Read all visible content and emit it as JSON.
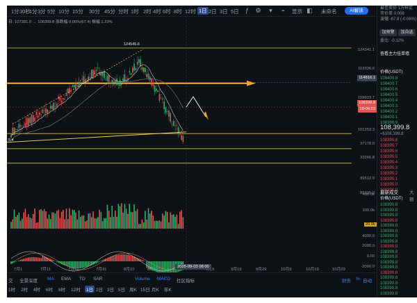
{
  "toolbar": {
    "timeframes": [
      "1分",
      "30秒",
      "1分",
      "3分",
      "5分",
      "10分",
      "15分",
      "30分",
      "45分",
      "分时",
      "1时",
      "2时",
      "4时",
      "6时",
      "8时",
      "12时",
      "1日",
      "2日",
      "3日",
      "5日"
    ],
    "active_timeframe_index": 16,
    "display_label": "显示",
    "unnamed_label": "未命名",
    "ai_label": "AI解读"
  },
  "legend": {
    "text": "日: 107281.0 → 108399.8  涨跌幅 0.06%(67.4) 振幅 1.23%",
    "ma_text": "MA(7) 108990  MA(30) 111080"
  },
  "price_axis": {
    "ticks": [
      "124341.1",
      "119336.6",
      "109923.7",
      "105016.1",
      "101253.3",
      "97178.0",
      "93266.8",
      "89512.9",
      "85925.9"
    ],
    "current_price": "108399.8",
    "countdown": "19:06:23",
    "crosshair_price": "114816.1",
    "high_label": "124545.6",
    "volume_ticks": [
      "400.0k",
      "200.0k",
      "20.0k"
    ],
    "macd_ticks": [
      "4000.0",
      "2000.0",
      "0.00",
      "-2000.0"
    ]
  },
  "x_axis": {
    "labels": [
      "7月1",
      "7月11",
      "7月21",
      "7月31",
      "8月10",
      "8月20",
      "9月9",
      "9月19",
      "9月29",
      "10月9",
      "10月19",
      "10月29"
    ],
    "crosshair_date": "2025-09-03 08:00"
  },
  "bottom_toolbar": {
    "row1": [
      "交",
      "全景深度",
      "MA",
      "EMA",
      "TD",
      "SAR"
    ],
    "row1_right": [
      "Volume",
      "MACD",
      "社区指标"
    ],
    "row2": [
      "1时",
      "2时",
      "4时",
      "6时",
      "8时",
      "12时",
      "1日",
      "2日",
      "3日",
      "5日",
      "周K",
      "15日",
      "月K",
      "年K"
    ],
    "active_row2_index": 6,
    "right_items": [
      "财务",
      "%",
      "自动"
    ]
  },
  "sidebar": {
    "top_rows": [
      "最佳卖价 1万样定",
      "市价单 0.008",
      "波幅 -67.8 (-0.06%)"
    ],
    "buttons": [
      "加预警",
      "加自选"
    ],
    "small_label": "委比: -0.12%",
    "orderbook_title": "查看主力挂单墙",
    "price_header": "价格(USDT)",
    "asks": [
      "108400.8",
      "108400.7",
      "108400.6",
      "108400.5",
      "108400.4",
      "108400.3",
      "108400.2",
      "108400.1",
      "108399.9"
    ],
    "last_price": "108,399.8",
    "last_price_sub": "≈$108,399.8",
    "bids": [
      "108399.8",
      "108399.7",
      "108399.6",
      "108399.5",
      "108399.4",
      "108399.3",
      "108399.2",
      "108399.1",
      "108399.0",
      "108398.9"
    ],
    "trades_tab": "最新成交",
    "big_tab": "大额",
    "trades_header": "价格(USDT)",
    "trades": [
      "108399.8",
      "108399.8",
      "108399.8",
      "108399.8",
      "108399.8",
      "108399.8",
      "108399.8",
      "108399.8",
      "108399.8",
      "108399.8",
      "108399.8",
      "108399.8",
      "108399.8",
      "108399.8",
      "108399.8",
      "108399.8",
      "108399.8",
      "108399.8"
    ]
  },
  "colors": {
    "up": "#2fb36b",
    "down": "#e25353",
    "horizontal_level": "#d9c24a",
    "arrow": "#f5a623",
    "background": "#0e1116"
  }
}
